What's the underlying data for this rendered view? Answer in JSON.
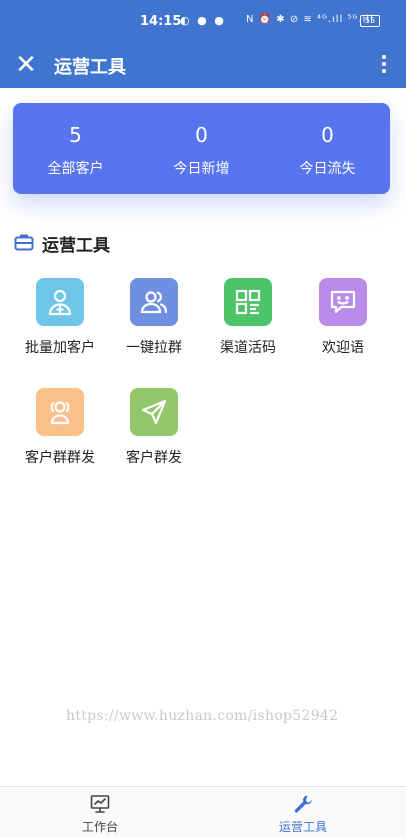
{
  "status_bar": {
    "time": "14:15",
    "left_icons": "◐ ● ●",
    "right_icons": "N ⏰ ✱ ⊘ ≋ ⁴ᴳ.ıll ⁵ᴳ.ıll",
    "battery": "55"
  },
  "header": {
    "title": "运营工具",
    "close_icon": "close-icon",
    "more_icon": "more-vertical-icon"
  },
  "stats": [
    {
      "value": "5",
      "label": "全部客户"
    },
    {
      "value": "0",
      "label": "今日新增"
    },
    {
      "value": "0",
      "label": "今日流失"
    }
  ],
  "section": {
    "title": "运营工具",
    "icon": "toolbox-icon"
  },
  "tools": [
    {
      "label": "批量加客户",
      "icon": "add-user-icon",
      "color": "#6dc6e6"
    },
    {
      "label": "一键拉群",
      "icon": "group-icon",
      "color": "#6f8fe3"
    },
    {
      "label": "渠道活码",
      "icon": "qr-code-icon",
      "color": "#4cc569"
    },
    {
      "label": "欢迎语",
      "icon": "chat-smile-icon",
      "color": "#b98cea"
    },
    {
      "label": "客户群群发",
      "icon": "group-broadcast-icon",
      "color": "#f9c08c"
    },
    {
      "label": "客户群发",
      "icon": "send-icon",
      "color": "#93c86a"
    }
  ],
  "watermark": "https://www.huzhan.com/ishop52942",
  "bottom_nav": [
    {
      "label": "工作台",
      "icon": "monitor-icon",
      "active": false
    },
    {
      "label": "运营工具",
      "icon": "wrench-icon",
      "active": true
    }
  ],
  "colors": {
    "header_bg": "#3f74cf",
    "card_bg": "#5875ef",
    "active_nav": "#3f6fd8"
  }
}
